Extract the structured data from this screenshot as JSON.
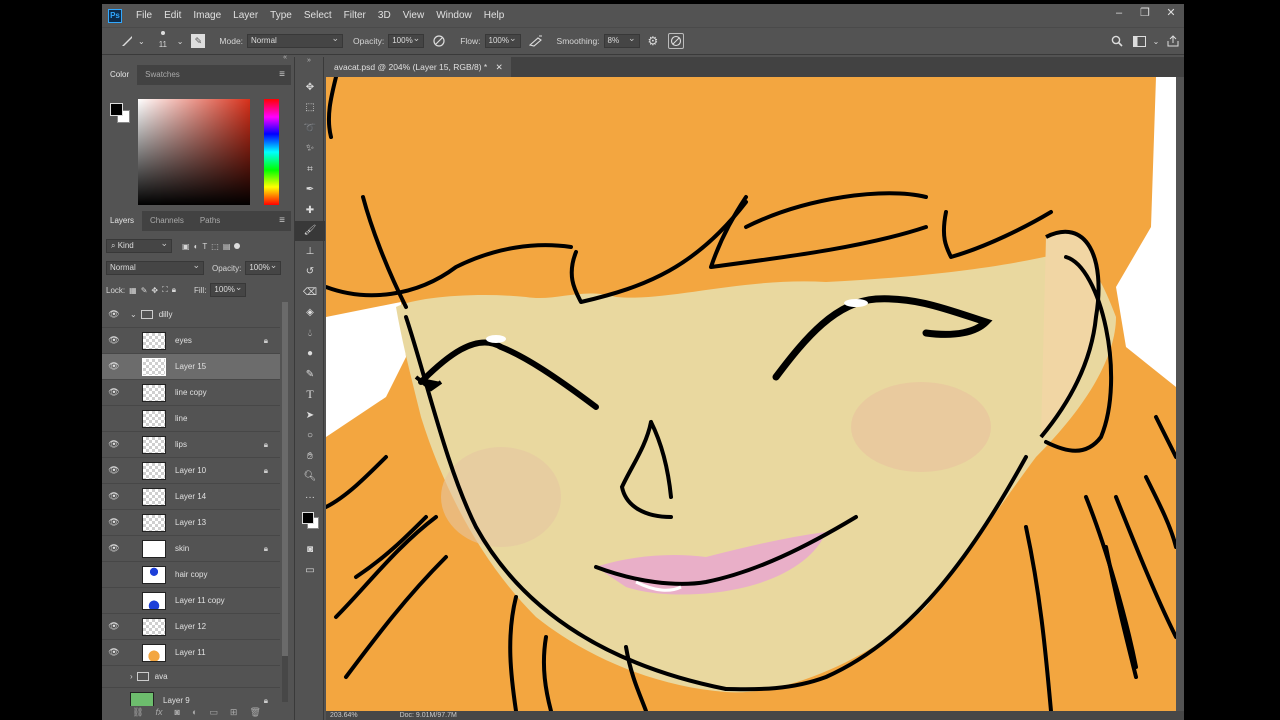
{
  "app": {
    "logo": "Ps"
  },
  "menu": [
    "File",
    "Edit",
    "Image",
    "Layer",
    "Type",
    "Select",
    "Filter",
    "3D",
    "View",
    "Window",
    "Help"
  ],
  "window_controls": [
    "minimize-icon",
    "restore-icon",
    "close-icon"
  ],
  "options_bar": {
    "brush_size": "11",
    "mode_label": "Mode:",
    "mode_value": "Normal",
    "opacity_label": "Opacity:",
    "opacity_value": "100%",
    "flow_label": "Flow:",
    "flow_value": "100%",
    "smoothing_label": "Smoothing:",
    "smoothing_value": "8%"
  },
  "color_panel": {
    "tabs": [
      "Color",
      "Swatches"
    ],
    "foreground": "#000000",
    "background": "#ffffff"
  },
  "layers_panel": {
    "tabs": [
      "Layers",
      "Channels",
      "Paths"
    ],
    "filter_value": "Kind",
    "blend_mode": "Normal",
    "opacity_label": "Opacity:",
    "opacity_value": "100%",
    "lock_label": "Lock:",
    "fill_label": "Fill:",
    "fill_value": "100%",
    "layers": [
      {
        "name": "dilly",
        "type": "group",
        "expanded": true,
        "visible": true
      },
      {
        "name": "eyes",
        "visible": true,
        "locked": true
      },
      {
        "name": "Layer 15",
        "visible": true,
        "selected": true
      },
      {
        "name": "line copy",
        "visible": true
      },
      {
        "name": "line",
        "visible": false
      },
      {
        "name": "lips",
        "visible": true,
        "locked": true
      },
      {
        "name": "Layer 10",
        "visible": true,
        "locked": true
      },
      {
        "name": "Layer 14",
        "visible": true
      },
      {
        "name": "Layer 13",
        "visible": true
      },
      {
        "name": "skin",
        "visible": true,
        "locked": true
      },
      {
        "name": "hair copy",
        "visible": false
      },
      {
        "name": "Layer 11 copy",
        "visible": false
      },
      {
        "name": "Layer 12",
        "visible": true
      },
      {
        "name": "Layer 11",
        "visible": true
      },
      {
        "name": "ava",
        "type": "group",
        "expanded": false,
        "visible": false
      },
      {
        "name": "Layer 9",
        "visible": false,
        "locked": true
      }
    ]
  },
  "document": {
    "tab_title": "avacat.psd @ 204% (Layer 15, RGB/8) *"
  },
  "status": {
    "zoom": "203.64%",
    "doc": "Doc: 9.01M/97.7M"
  }
}
